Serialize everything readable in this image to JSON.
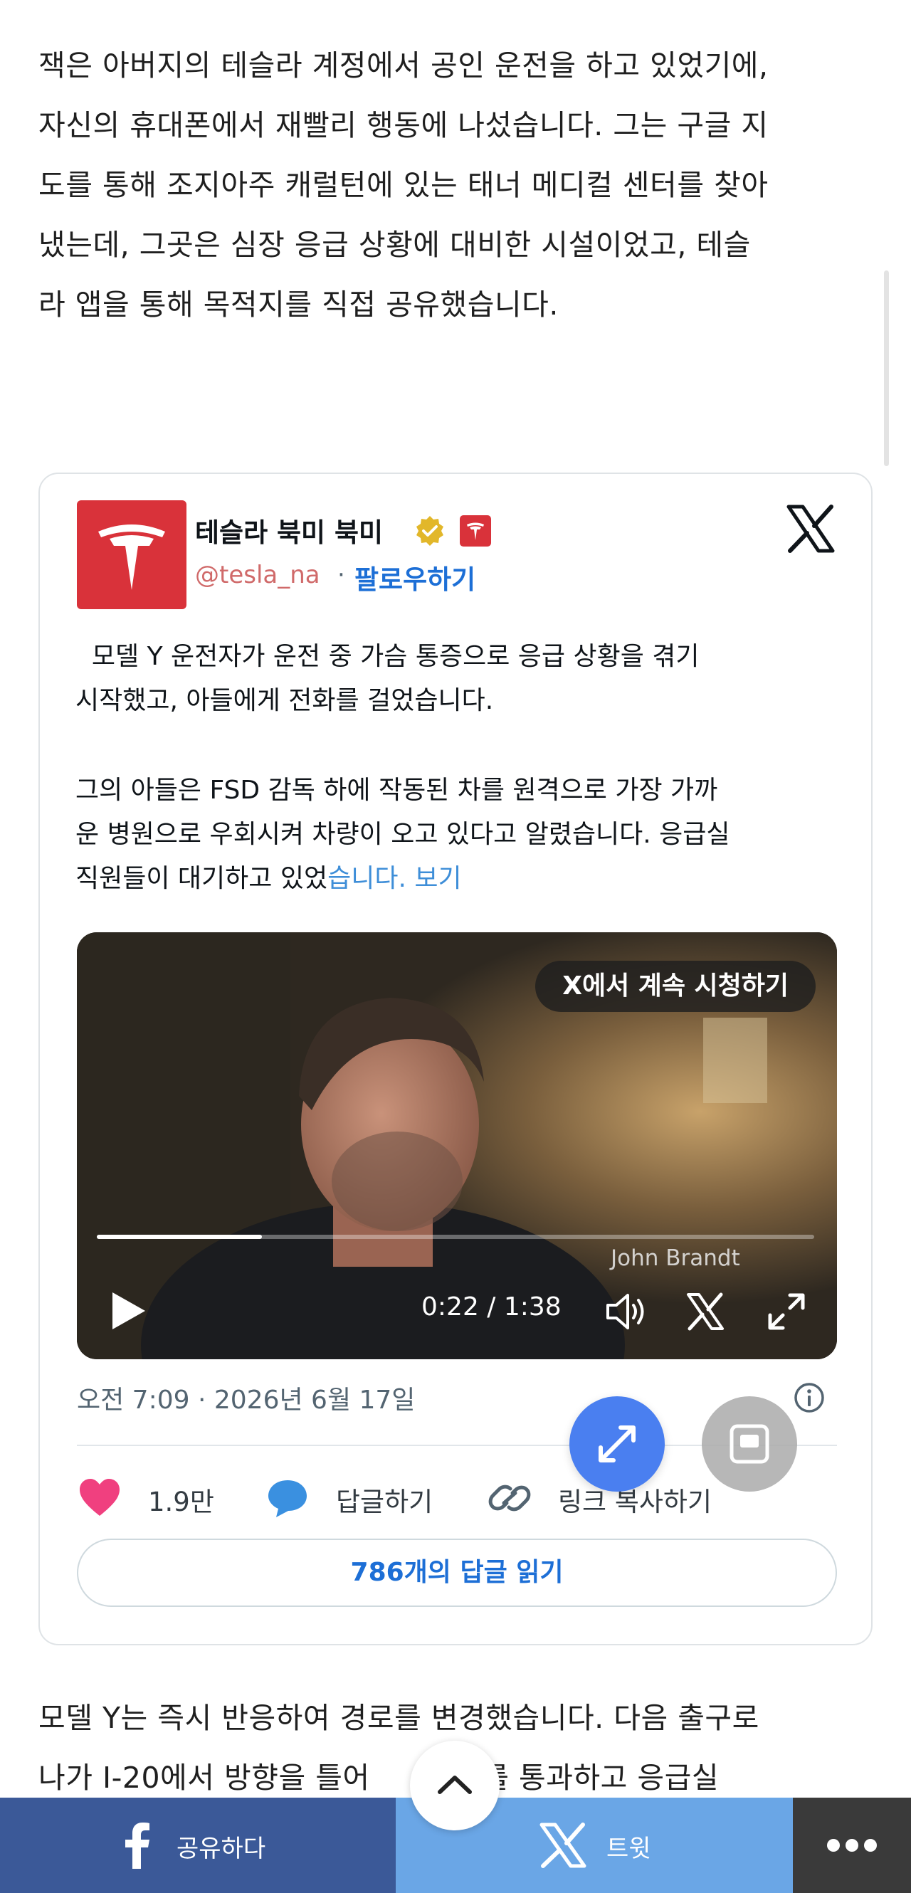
{
  "article": {
    "paragraph1_lines": [
      "잭은 아버지의 테슬라 계정에서 공인 운전을 하고 있었기에,",
      "자신의 휴대폰에서 재빨리 행동에 나섰습니다. 그는 구글 지",
      "도를 통해 조지아주 캐럴턴에 있는 태너 메디컬 센터를 찾아",
      "냈는데, 그곳은 심장 응급 상황에 대비한 시설이었고, 테슬",
      "라 앱을 통해 목적지를 직접 공유했습니다."
    ],
    "paragraph2_lines": [
      "모델 Y는 즉시 반응하여 경로를 변경했습니다. 다음 출구로",
      "나가 I-20에서 방향을 틀어      도로를 통과하고 응급실"
    ]
  },
  "tweet": {
    "account_name": "테슬라 북미 북미",
    "handle": "@tesla_na",
    "separator": "·",
    "follow_label": "팔로우하기",
    "text_paragraph1_lines": [
      "  모델 Y 운전자가 운전 중 가슴 통증으로 응급 상황을 겪기",
      "시작했고, 아들에게 전화를 걸었습니다."
    ],
    "text_paragraph2_lines": [
      "그의 아들은 FSD 감독 하에 작동된 차를 원격으로 가장 가까",
      "운 병원으로 우회시켜 차량이 오고 있다고 알렸습니다. 응급실"
    ],
    "text_last_line": "직원들이 대기하고 있었",
    "show_more": "습니다. 보기",
    "video": {
      "watch_on_x": "X에서 계속 시청하기",
      "caption_name": "John Brandt",
      "time": "0:22 / 1:38",
      "progress": 0.23
    },
    "timestamp": "오전 7:09 · 2026년 6월 17일",
    "likes": "1.9만",
    "reply_label": "답글하기",
    "copy_link_label": "링크 복사하기",
    "read_replies_label": "786개의 답글 읽기"
  },
  "share_bar": {
    "facebook_label": "공유하다",
    "tweet_label": "트윗"
  },
  "colors": {
    "facebook": "#3b5998",
    "twitter": "#6aa6e6",
    "more": "#3a3a3a",
    "link_blue": "#1d6fd6",
    "fab_blue": "#4a7ff0",
    "tesla_red": "#d9323a",
    "like_pink": "#f0407f"
  },
  "icons": [
    "tesla-logo-icon",
    "verified-icon",
    "x-logo-icon",
    "play-icon",
    "volume-icon",
    "fullscreen-icon",
    "info-icon",
    "heart-icon",
    "reply-bubble-icon",
    "link-icon",
    "expand-icon",
    "pip-icon",
    "facebook-icon",
    "chevron-up-icon",
    "more-dots-icon"
  ]
}
